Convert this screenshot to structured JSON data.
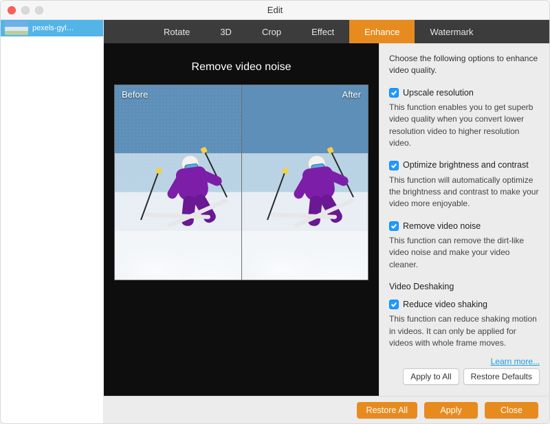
{
  "window": {
    "title": "Edit"
  },
  "sidebar": {
    "items": [
      {
        "name": "pexels-gyl…"
      }
    ]
  },
  "tabs": [
    {
      "label": "Rotate",
      "active": false
    },
    {
      "label": "3D",
      "active": false
    },
    {
      "label": "Crop",
      "active": false
    },
    {
      "label": "Effect",
      "active": false
    },
    {
      "label": "Enhance",
      "active": true
    },
    {
      "label": "Watermark",
      "active": false
    }
  ],
  "preview": {
    "heading": "Remove video noise",
    "before_label": "Before",
    "after_label": "After"
  },
  "panel": {
    "intro": "Choose the following options to enhance video quality.",
    "options": [
      {
        "label": "Upscale resolution",
        "checked": true,
        "desc": "This function enables you to get superb video quality when you convert lower resolution video to higher resolution video."
      },
      {
        "label": "Optimize brightness and contrast",
        "checked": true,
        "desc": "This function will automatically optimize the brightness and contrast to make your video more enjoyable."
      },
      {
        "label": "Remove video noise",
        "checked": true,
        "desc": "This function can remove the dirt-like video noise and make your video cleaner."
      }
    ],
    "section2_heading": "Video Deshaking",
    "deshake": {
      "label": "Reduce video shaking",
      "checked": true,
      "desc": "This function can reduce shaking motion in videos. It can only be applied for videos with whole frame moves."
    },
    "learn_more": "Learn more...",
    "apply_all": "Apply to All",
    "restore_defaults": "Restore Defaults"
  },
  "footer": {
    "restore_all": "Restore All",
    "apply": "Apply",
    "close": "Close"
  },
  "colors": {
    "accent": "#e78b1f",
    "checkbox": "#1f9bff",
    "link": "#1a9be0"
  }
}
